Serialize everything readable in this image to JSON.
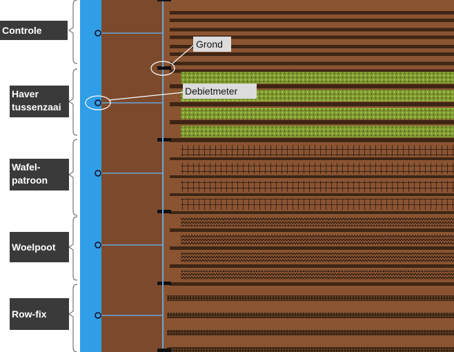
{
  "colors": {
    "water": "#2f9ee6",
    "soil_lane": "#7b4a2c",
    "field": "#8a5432",
    "furrow": "#3e2514",
    "label_bg": "#3a3a3a",
    "label_text": "#ffffff",
    "callout_bg": "#dcdcdc",
    "grass": "#7c9b2e",
    "pipe": "#6aa6d6"
  },
  "sections": [
    {
      "id": "controle",
      "lines": [
        "Controle"
      ],
      "pattern": "none"
    },
    {
      "id": "haver-tussenzaai",
      "lines": [
        "Haver",
        "tussenzaai"
      ],
      "pattern": "oat-cover-crop"
    },
    {
      "id": "wafelpatroon",
      "lines": [
        "Wafel-",
        "patroon"
      ],
      "pattern": "waffle-grid"
    },
    {
      "id": "woelpoot",
      "lines": [
        "Woelpoot"
      ],
      "pattern": "zigzag"
    },
    {
      "id": "row-fix",
      "lines": [
        "Row-fix"
      ],
      "pattern": "dotted-rows"
    }
  ],
  "callouts": {
    "soil": "Grond",
    "flow_meter": "Debietmeter"
  }
}
